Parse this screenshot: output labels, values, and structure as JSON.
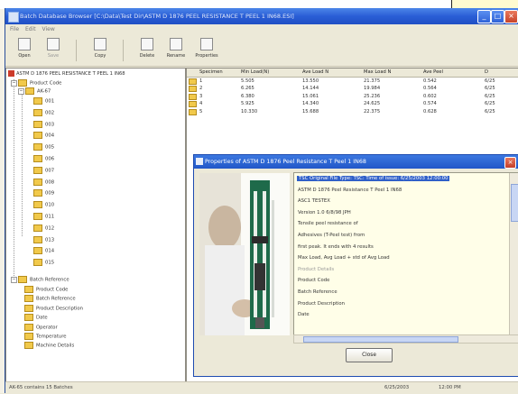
{
  "window": {
    "title": "Batch Database Browser [C:\\Data\\Test Dir\\ASTM D 1876 PEEL RESISTANCE T PEEL 1 IN68.ESI]",
    "controls": [
      "_",
      "□",
      "×"
    ]
  },
  "menu": [
    "File",
    "Edit",
    "View"
  ],
  "toolbar": [
    {
      "label": "Open",
      "icon": "open-icon"
    },
    {
      "label": "Save",
      "icon": "save-icon"
    },
    {
      "label": "Copy",
      "icon": "copy-icon"
    },
    {
      "label": "Delete",
      "icon": "delete-icon"
    },
    {
      "label": "Rename",
      "icon": "rename-icon"
    },
    {
      "label": "Properties",
      "icon": "properties-icon"
    }
  ],
  "tree": {
    "root": "ASTM D 1876 PEEL RESISTANCE T PEEL 1 IN68",
    "product_code": "Product Code",
    "batch_folder": "AK-67",
    "batches": [
      "001",
      "002",
      "003",
      "004",
      "005",
      "006",
      "007",
      "008",
      "009",
      "010",
      "011",
      "012",
      "013",
      "014",
      "015"
    ],
    "batch_reference": "Batch Reference",
    "reference_items": [
      "Product Code",
      "Batch Reference",
      "Product Description",
      "Date",
      "Operator",
      "Temperature",
      "Machine Details"
    ]
  },
  "grid": {
    "headers": [
      "Specimen",
      "Min Load(N)",
      "Ave Load N",
      "Max Load N",
      "Ave Peel",
      "D"
    ],
    "rows": [
      [
        "1",
        "5.505",
        "13.550",
        "21.375",
        "0.542",
        "6/25"
      ],
      [
        "2",
        "6.265",
        "14.144",
        "19.984",
        "0.564",
        "6/25"
      ],
      [
        "3",
        "6.380",
        "15.061",
        "25.236",
        "0.602",
        "6/25"
      ],
      [
        "4",
        "5.925",
        "14.340",
        "24.625",
        "0.574",
        "6/25"
      ],
      [
        "5",
        "10.330",
        "15.688",
        "22.375",
        "0.628",
        "6/25"
      ]
    ]
  },
  "status": {
    "left": "AK-65 contains 15 Batches",
    "date": "6/25/2003",
    "time": "12:00 PM"
  },
  "dialog": {
    "title": "Properties of ASTM D 1876 Peel Resistance T Peel 1 IN68",
    "items": [
      "TSC Original File Type: TSC: Time of issue: 6/25/2003 12:00:00",
      "ASTM D 1876 Peel Resistance T Peel 1 IN68",
      "ASC1 TESTEX",
      "Version 1.0 6/8/98 JPH",
      "Tensile peel resistance of",
      "Adhesives (T-Peel test) from",
      "first peak. It ends with 4 results",
      "Max Load, Avg Load + std of Avg Load",
      "Product Details",
      "Product Code",
      "Batch Reference",
      "Product Description",
      "Date"
    ],
    "selected_index": 0,
    "dim_index": 8,
    "close_label": "Close"
  },
  "colors": {
    "title_blue": "#2a5ed6",
    "folder_yellow": "#f1c94b",
    "selection_blue": "#2f5fc8",
    "info_bg": "#fffee8"
  }
}
